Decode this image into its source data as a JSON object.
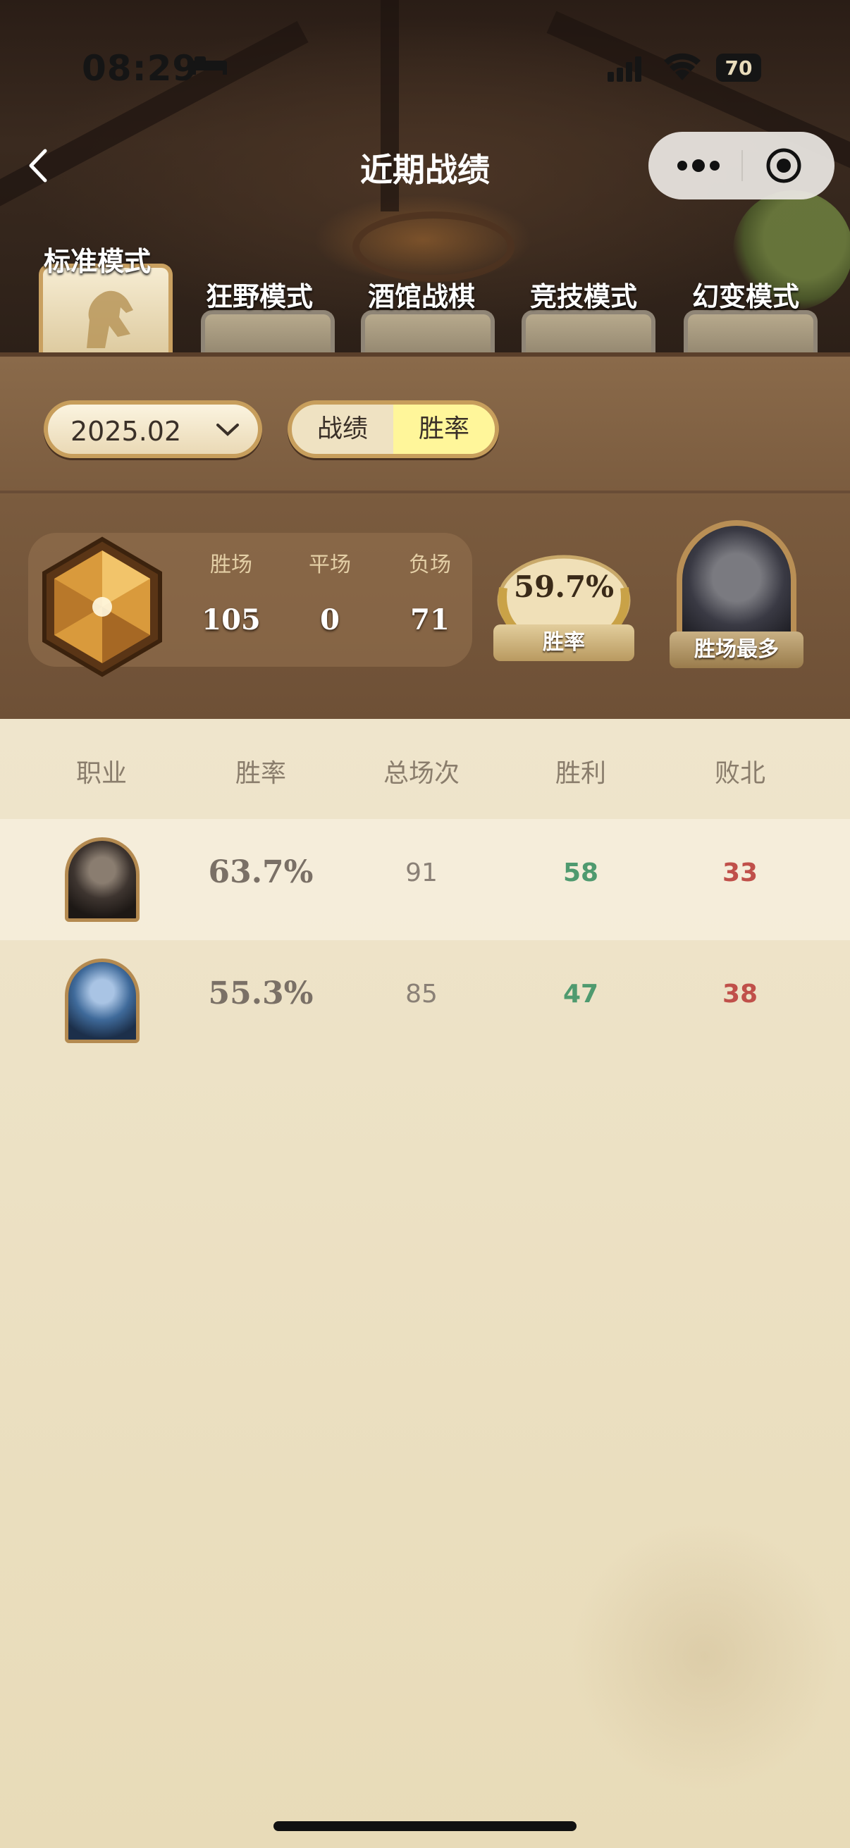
{
  "status_bar": {
    "time": "08:29",
    "battery": "70"
  },
  "nav": {
    "title": "近期战绩"
  },
  "tabs": [
    {
      "label": "标准模式",
      "active": true
    },
    {
      "label": "狂野模式",
      "active": false
    },
    {
      "label": "酒馆战棋",
      "active": false
    },
    {
      "label": "竞技模式",
      "active": false
    },
    {
      "label": "幻变模式",
      "active": false
    }
  ],
  "filters": {
    "date": "2025.02",
    "toggle_left": "战绩",
    "toggle_right": "胜率",
    "toggle_selected": "胜率"
  },
  "summary": {
    "wins_label": "胜场",
    "wins": "105",
    "draws_label": "平场",
    "draws": "0",
    "losses_label": "负场",
    "losses": "71",
    "win_rate": "59.7%",
    "win_rate_label": "胜率",
    "most_wins_label": "胜场最多"
  },
  "table": {
    "headers": [
      "职业",
      "胜率",
      "总场次",
      "胜利",
      "败北"
    ],
    "rows": [
      {
        "class_icon": "class-portrait-dark",
        "rate": "63.7%",
        "total": "91",
        "wins": "58",
        "losses": "33"
      },
      {
        "class_icon": "class-portrait-blue",
        "rate": "55.3%",
        "total": "85",
        "wins": "47",
        "losses": "38"
      }
    ]
  },
  "colors": {
    "win": "#4f9a6f",
    "loss": "#c0504a",
    "toggle_selected_bg": "#fff69a"
  }
}
